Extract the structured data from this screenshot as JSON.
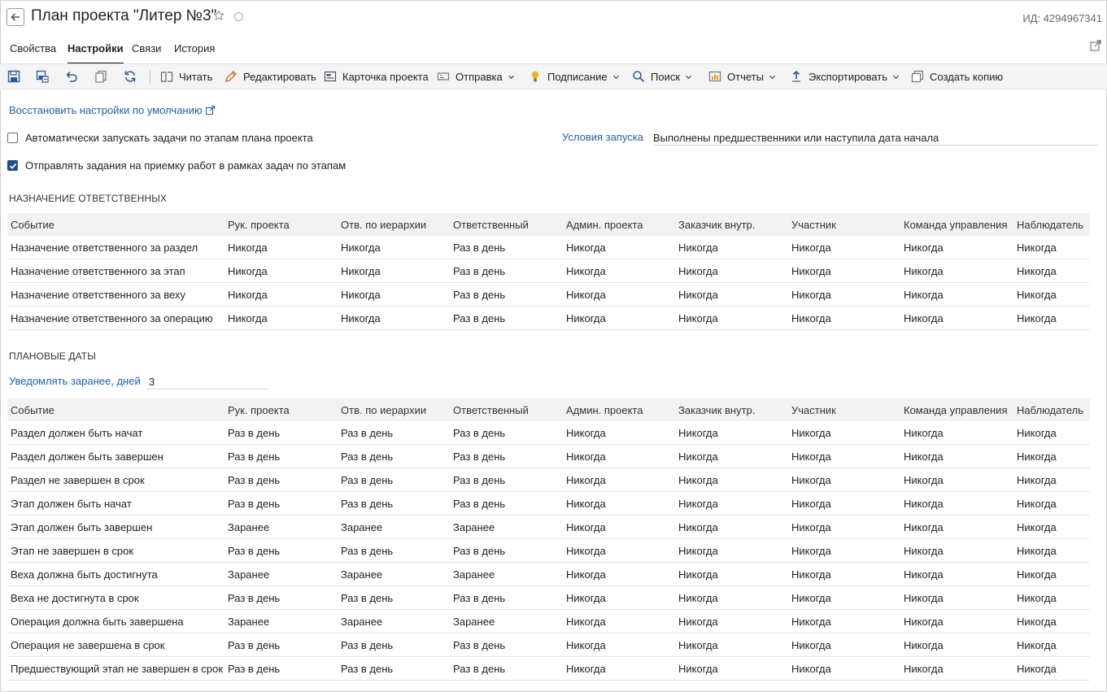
{
  "header": {
    "title": "План проекта \"Литер №3\"",
    "id_label": "ИД: 4294967341"
  },
  "tabs": [
    {
      "label": "Свойства",
      "active": false
    },
    {
      "label": "Настройки",
      "active": true
    },
    {
      "label": "Связи",
      "active": false
    },
    {
      "label": "История",
      "active": false
    }
  ],
  "toolbar": {
    "icons": [
      "save-icon",
      "save-close-icon",
      "undo-icon",
      "copy-icon",
      "refresh-icon"
    ],
    "items": [
      {
        "label": "Читать",
        "icon": "book-icon",
        "dropdown": false
      },
      {
        "label": "Редактировать",
        "icon": "pencil-icon",
        "dropdown": false
      },
      {
        "label": "Карточка проекта",
        "icon": "card-icon",
        "dropdown": false
      },
      {
        "label": "Отправка",
        "icon": "send-icon",
        "dropdown": true
      },
      {
        "label": "Подписание",
        "icon": "signature-icon",
        "dropdown": true
      },
      {
        "label": "Поиск",
        "icon": "search-icon",
        "dropdown": true
      },
      {
        "label": "Отчеты",
        "icon": "report-icon",
        "dropdown": true
      },
      {
        "label": "Экспортировать",
        "icon": "export-icon",
        "dropdown": true
      },
      {
        "label": "Создать копию",
        "icon": "duplicate-icon",
        "dropdown": false
      }
    ]
  },
  "settings": {
    "restore_link": "Восстановить настройки по умолчанию",
    "auto_start": {
      "label": "Автоматически запускать задачи по этапам плана проекта",
      "checked": false
    },
    "send_tasks": {
      "label": "Отправлять задания на приемку работ в рамках задач по этапам",
      "checked": true
    },
    "launch_conditions_label": "Условия запуска",
    "launch_conditions_value": "Выполнены предшественники или наступила дата начала"
  },
  "assignment": {
    "section_title": "НАЗНАЧЕНИЕ ОТВЕТСТВЕННЫХ",
    "columns": [
      "Событие",
      "Рук. проекта",
      "Отв. по иерархии",
      "Ответственный",
      "Админ. проекта",
      "Заказчик внутр.",
      "Участник",
      "Команда управления",
      "Наблюдатель"
    ],
    "rows": [
      [
        "Назначение ответственного за раздел",
        "Никогда",
        "Никогда",
        "Раз в день",
        "Никогда",
        "Никогда",
        "Никогда",
        "Никогда",
        "Никогда"
      ],
      [
        "Назначение ответственного за этап",
        "Никогда",
        "Никогда",
        "Раз в день",
        "Никогда",
        "Никогда",
        "Никогда",
        "Никогда",
        "Никогда"
      ],
      [
        "Назначение ответственного за веху",
        "Никогда",
        "Никогда",
        "Раз в день",
        "Никогда",
        "Никогда",
        "Никогда",
        "Никогда",
        "Никогда"
      ],
      [
        "Назначение ответственного за операцию",
        "Никогда",
        "Никогда",
        "Раз в день",
        "Никогда",
        "Никогда",
        "Никогда",
        "Никогда",
        "Никогда"
      ]
    ]
  },
  "planned": {
    "section_title": "ПЛАНОВЫЕ ДАТЫ",
    "notify_label": "Уведомлять заранее, дней",
    "notify_value": "3",
    "columns": [
      "Событие",
      "Рук. проекта",
      "Отв. по иерархии",
      "Ответственный",
      "Админ. проекта",
      "Заказчик внутр.",
      "Участник",
      "Команда управления",
      "Наблюдатель"
    ],
    "rows": [
      [
        "Раздел должен быть начат",
        "Раз в день",
        "Раз в день",
        "Раз в день",
        "Никогда",
        "Никогда",
        "Никогда",
        "Никогда",
        "Никогда"
      ],
      [
        "Раздел должен быть завершен",
        "Раз в день",
        "Раз в день",
        "Раз в день",
        "Никогда",
        "Никогда",
        "Никогда",
        "Никогда",
        "Никогда"
      ],
      [
        "Раздел не завершен в срок",
        "Раз в день",
        "Раз в день",
        "Раз в день",
        "Никогда",
        "Никогда",
        "Никогда",
        "Никогда",
        "Никогда"
      ],
      [
        "Этап должен быть начат",
        "Раз в день",
        "Раз в день",
        "Раз в день",
        "Никогда",
        "Никогда",
        "Никогда",
        "Никогда",
        "Никогда"
      ],
      [
        "Этап должен быть завершен",
        "Заранее",
        "Заранее",
        "Заранее",
        "Никогда",
        "Никогда",
        "Никогда",
        "Никогда",
        "Никогда"
      ],
      [
        "Этап не завершен в срок",
        "Раз в день",
        "Раз в день",
        "Раз в день",
        "Никогда",
        "Никогда",
        "Никогда",
        "Никогда",
        "Никогда"
      ],
      [
        "Веха должна быть достигнута",
        "Заранее",
        "Заранее",
        "Заранее",
        "Никогда",
        "Никогда",
        "Никогда",
        "Никогда",
        "Никогда"
      ],
      [
        "Веха не достигнута в срок",
        "Раз в день",
        "Раз в день",
        "Раз в день",
        "Никогда",
        "Никогда",
        "Никогда",
        "Никогда",
        "Никогда"
      ],
      [
        "Операция должна быть завершена",
        "Заранее",
        "Заранее",
        "Заранее",
        "Никогда",
        "Никогда",
        "Никогда",
        "Никогда",
        "Никогда"
      ],
      [
        "Операция не завершена в срок",
        "Раз в день",
        "Раз в день",
        "Раз в день",
        "Никогда",
        "Никогда",
        "Никогда",
        "Никогда",
        "Никогда"
      ],
      [
        "Предшествующий этап не завершен в срок",
        "Раз в день",
        "Раз в день",
        "Раз в день",
        "Никогда",
        "Никогда",
        "Никогда",
        "Никогда",
        "Никогда"
      ]
    ]
  }
}
